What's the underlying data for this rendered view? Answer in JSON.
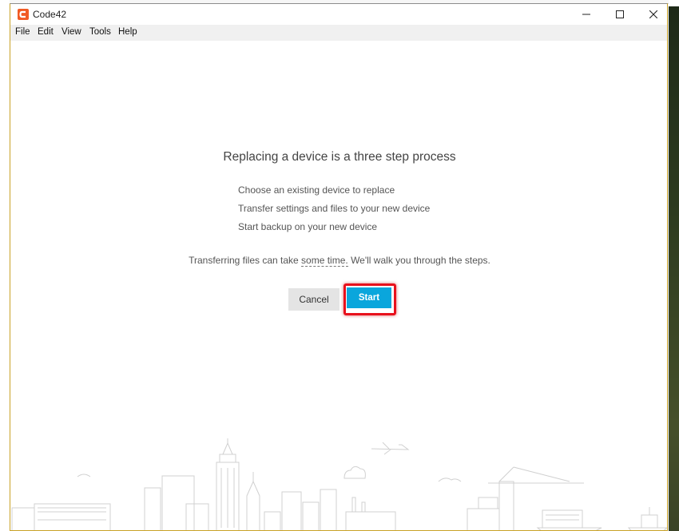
{
  "window": {
    "title": "Code42",
    "controls": {
      "minimize": "minimize-icon",
      "maximize": "maximize-icon",
      "close": "close-icon"
    }
  },
  "menu": [
    "File",
    "Edit",
    "View",
    "Tools",
    "Help"
  ],
  "main": {
    "heading": "Replacing a device is a three step process",
    "steps": [
      "Choose an existing device to replace",
      "Transfer settings and files to your new device",
      "Start backup on your new device"
    ],
    "note_before": "Transferring files can take ",
    "note_link": "some time.",
    "note_after": " We'll walk you through the steps.",
    "cancel_label": "Cancel",
    "start_label": "Start"
  },
  "colors": {
    "brand": "#f15a24",
    "primary_button": "#0aa6dc",
    "highlight": "#e8101c"
  }
}
